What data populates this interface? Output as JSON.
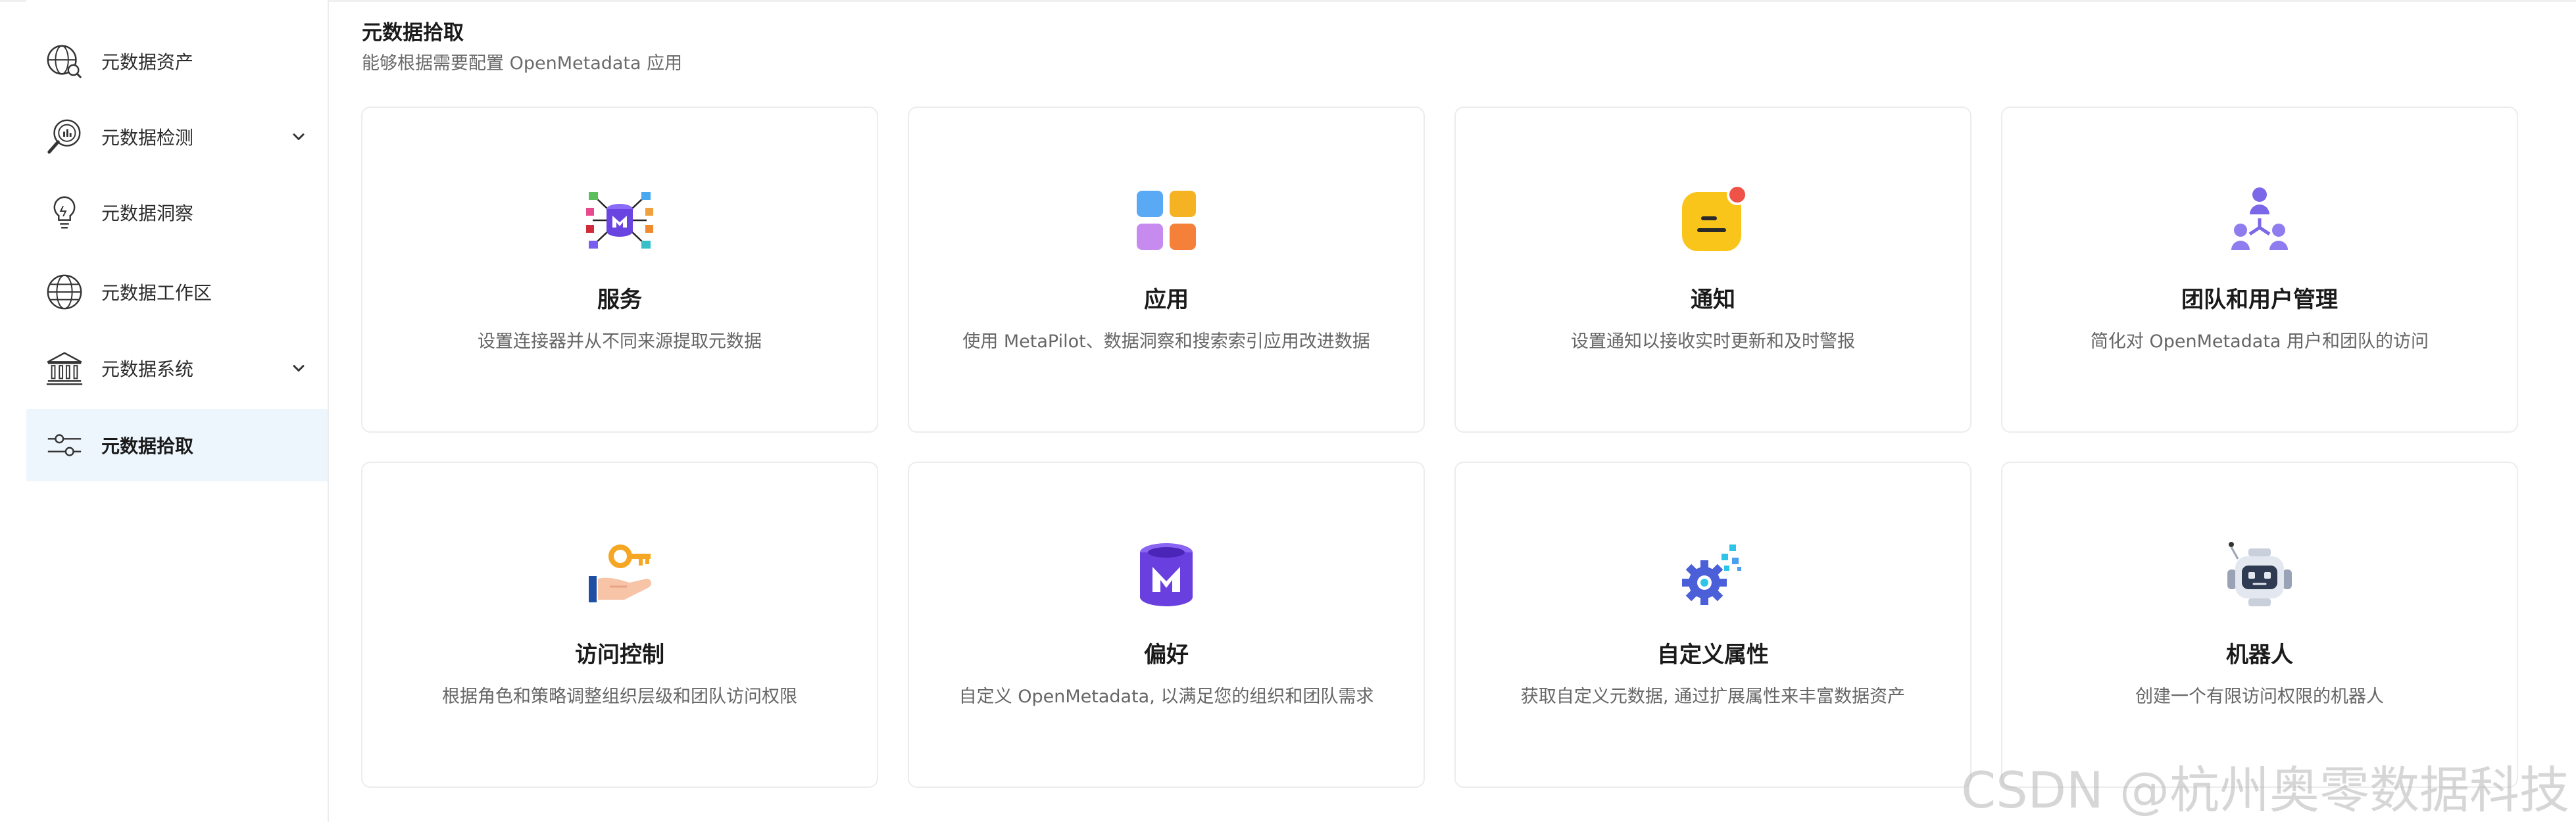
{
  "sidebar": {
    "items": [
      {
        "label": "元数据资产",
        "icon": "globe-search-icon"
      },
      {
        "label": "元数据检测",
        "icon": "magnify-chart-icon",
        "expandable": true
      },
      {
        "label": "元数据洞察",
        "icon": "lightbulb-icon"
      },
      {
        "label": "元数据工作区",
        "icon": "globe-icon"
      },
      {
        "label": "元数据系统",
        "icon": "bank-icon",
        "expandable": true
      },
      {
        "label": "元数据拾取",
        "icon": "sliders-icon",
        "active": true
      }
    ]
  },
  "header": {
    "title": "元数据拾取",
    "subtitle": "能够根据需要配置 OpenMetadata 应用"
  },
  "cards": [
    {
      "title": "服务",
      "desc": "设置连接器并从不同来源提取元数据",
      "icon": "services-hub-icon"
    },
    {
      "title": "应用",
      "desc": "使用 MetaPilot、数据洞察和搜索索引应用改进数据",
      "icon": "apps-grid-icon"
    },
    {
      "title": "通知",
      "desc": "设置通知以接收实时更新和及时警报",
      "icon": "notification-icon"
    },
    {
      "title": "团队和用户管理",
      "desc": "简化对 OpenMetadata 用户和团队的访问",
      "icon": "team-users-icon"
    },
    {
      "title": "访问控制",
      "desc": "根据角色和策略调整组织层级和团队访问权限",
      "icon": "key-hand-icon"
    },
    {
      "title": "偏好",
      "desc": "自定义 OpenMetadata, 以满足您的组织和团队需求",
      "icon": "openmetadata-logo-icon"
    },
    {
      "title": "自定义属性",
      "desc": "获取自定义元数据, 通过扩展属性来丰富数据资产",
      "icon": "gear-pixels-icon"
    },
    {
      "title": "机器人",
      "desc": "创建一个有限访问权限的机器人",
      "icon": "robot-icon"
    }
  ],
  "watermark": "CSDN @杭州奥零数据科技",
  "colors": {
    "active_bg": "#eef6fd",
    "accent_purple": "#7147e8"
  }
}
